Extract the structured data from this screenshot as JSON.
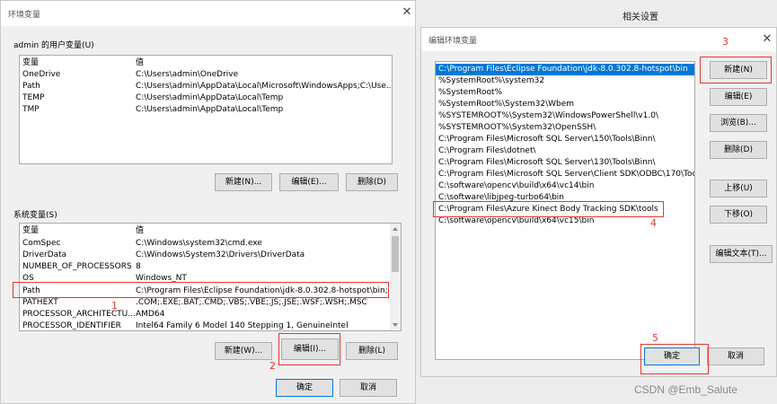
{
  "env_window": {
    "title": "环境变量",
    "close_glyph": "✕",
    "user_group_label": "admin 的用户变量(U)",
    "user_headers": [
      "变量",
      "值"
    ],
    "user_rows": [
      [
        "OneDrive",
        "C:\\Users\\admin\\OneDrive"
      ],
      [
        "Path",
        "C:\\Users\\admin\\AppData\\Local\\Microsoft\\WindowsApps;C:\\Use..."
      ],
      [
        "TEMP",
        "C:\\Users\\admin\\AppData\\Local\\Temp"
      ],
      [
        "TMP",
        "C:\\Users\\admin\\AppData\\Local\\Temp"
      ]
    ],
    "user_buttons": [
      "新建(N)...",
      "编辑(E)...",
      "删除(D)"
    ],
    "sys_group_label": "系统变量(S)",
    "sys_headers": [
      "变量",
      "值"
    ],
    "sys_rows": [
      [
        "ComSpec",
        "C:\\Windows\\system32\\cmd.exe"
      ],
      [
        "DriverData",
        "C:\\Windows\\System32\\Drivers\\DriverData"
      ],
      [
        "NUMBER_OF_PROCESSORS",
        "8"
      ],
      [
        "OS",
        "Windows_NT"
      ],
      [
        "Path",
        "C:\\Program Files\\Eclipse Foundation\\jdk-8.0.302.8-hotspot\\bin;..."
      ],
      [
        "PATHEXT",
        ".COM;.EXE;.BAT;.CMD;.VBS;.VBE;.JS;.JSE;.WSF;.WSH;.MSC"
      ],
      [
        "PROCESSOR_ARCHITECTU...",
        "AMD64"
      ],
      [
        "PROCESSOR_IDENTIFIER",
        "Intel64 Family 6 Model 140 Stepping 1, GenuineIntel"
      ]
    ],
    "sys_buttons": [
      "新建(W)...",
      "编辑(I)...",
      "删除(L)"
    ],
    "ok": "确定",
    "cancel": "取消"
  },
  "background": {
    "related_settings": "相关设置"
  },
  "edit_window": {
    "title": "编辑环境变量",
    "close_glyph": "✕",
    "paths": [
      "C:\\Program Files\\Eclipse Foundation\\jdk-8.0.302.8-hotspot\\bin",
      "%SystemRoot%\\system32",
      "%SystemRoot%",
      "%SystemRoot%\\System32\\Wbem",
      "%SYSTEMROOT%\\System32\\WindowsPowerShell\\v1.0\\",
      "%SYSTEMROOT%\\System32\\OpenSSH\\",
      "C:\\Program Files\\Microsoft SQL Server\\150\\Tools\\Binn\\",
      "C:\\Program Files\\dotnet\\",
      "C:\\Program Files\\Microsoft SQL Server\\130\\Tools\\Binn\\",
      "C:\\Program Files\\Microsoft SQL Server\\Client SDK\\ODBC\\170\\Too...",
      "C:\\software\\opencv\\build\\x64\\vc14\\bin",
      "C:\\software\\libjpeg-turbo64\\bin",
      "C:\\Program Files\\Azure Kinect Body Tracking SDK\\tools",
      "C:\\software\\opencv\\build\\x64\\vc15\\bin"
    ],
    "buttons": [
      "新建(N)",
      "编辑(E)",
      "浏览(B)...",
      "删除(D)",
      "上移(U)",
      "下移(O)",
      "编辑文本(T)..."
    ],
    "ok": "确定",
    "cancel": "取消"
  },
  "annotations": [
    "1",
    "2",
    "3",
    "4",
    "5"
  ],
  "watermark": "CSDN @Emb_Salute",
  "colors": {
    "accent": "#0078d7",
    "annotation": "#e8342e"
  }
}
